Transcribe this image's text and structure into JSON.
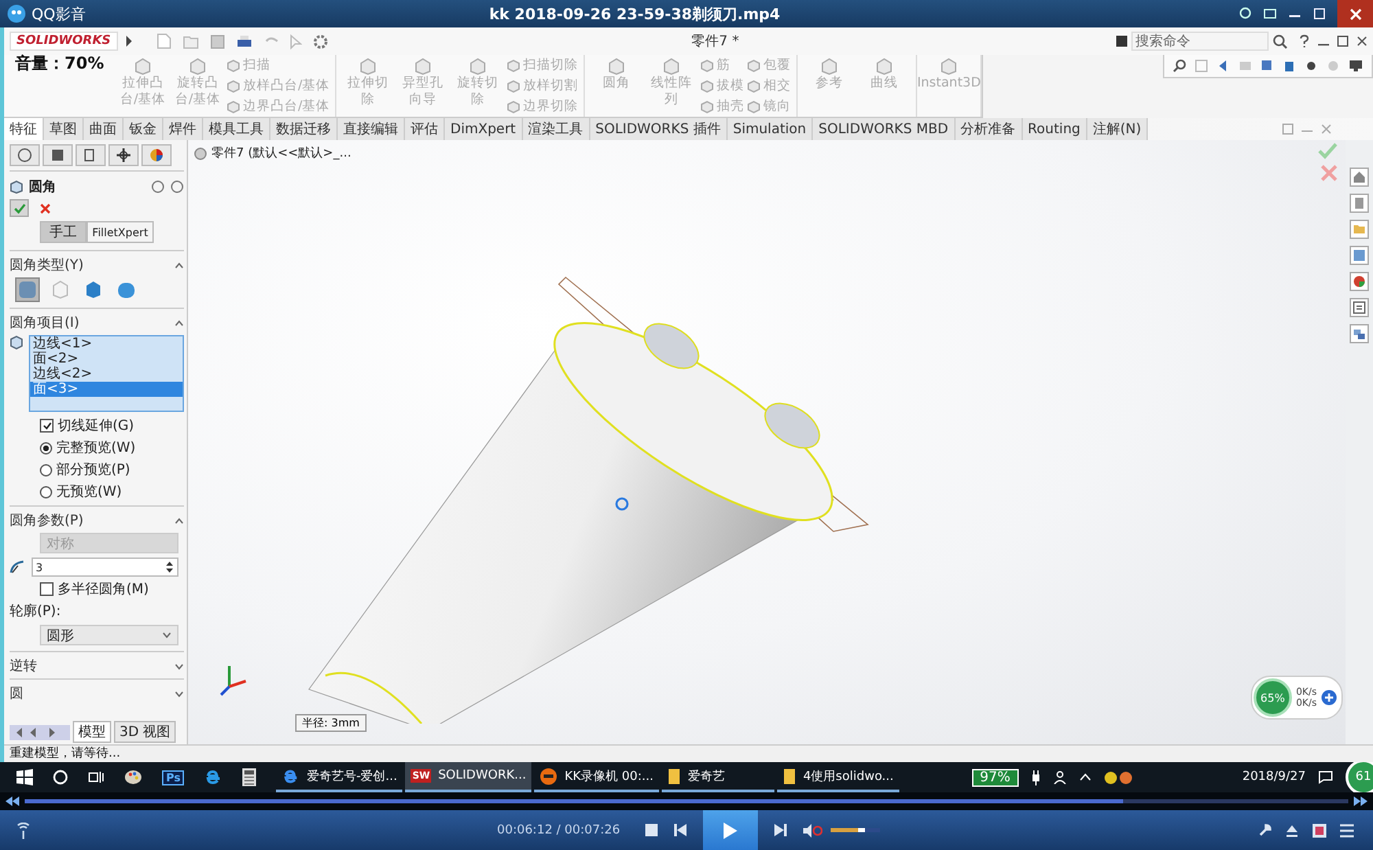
{
  "player": {
    "app_name": "QQ影音",
    "title": "kk 2018-09-26 23-59-38剃须刀.mp4",
    "osd": "音量：70%",
    "time": "00:06:12 / 00:07:26",
    "seek": {
      "level": 0.83
    },
    "volume": {
      "level": 0.7
    }
  },
  "solidworks": {
    "logo": "SOLIDWORKS",
    "document_title": "零件7 *",
    "search": {
      "placeholder": "搜索命令"
    },
    "ribbon": [
      [
        [
          "拉伸凸台/基体"
        ],
        [
          "旋转凸台/基体"
        ],
        [
          "扫描",
          "放样凸台/基体",
          "边界凸台/基体"
        ]
      ],
      [
        [
          "拉伸切除"
        ],
        [
          "异型孔向导"
        ],
        [
          "旋转切除"
        ],
        [
          "扫描切除",
          "放样切割",
          "边界切除"
        ]
      ],
      [
        [
          "圆角"
        ],
        [
          "线性阵列"
        ],
        [
          "筋",
          "拔模",
          "抽壳"
        ],
        [
          "包覆",
          "相交",
          "镜向"
        ]
      ],
      [
        [
          "参考"
        ],
        [
          "曲线"
        ]
      ],
      [
        [
          "Instant3D"
        ]
      ]
    ],
    "tabs": [
      {
        "label": "特征",
        "selected": true
      },
      {
        "label": "草图",
        "selected": false
      },
      {
        "label": "曲面",
        "selected": false
      },
      {
        "label": "钣金",
        "selected": false
      },
      {
        "label": "焊件",
        "selected": false
      },
      {
        "label": "模具工具",
        "selected": false
      },
      {
        "label": "数据迁移",
        "selected": false
      },
      {
        "label": "直接编辑",
        "selected": false
      },
      {
        "label": "评估",
        "selected": false
      },
      {
        "label": "DimXpert",
        "selected": false
      },
      {
        "label": "渲染工具",
        "selected": false
      },
      {
        "label": "SOLIDWORKS 插件",
        "selected": false
      },
      {
        "label": "Simulation",
        "selected": false
      },
      {
        "label": "SOLIDWORKS MBD",
        "selected": false
      },
      {
        "label": "分析准备",
        "selected": false
      },
      {
        "label": "Routing",
        "selected": false
      },
      {
        "label": "注解(N)",
        "selected": false
      }
    ],
    "property_manager": {
      "title": "圆角",
      "mode_buttons": [
        {
          "label": "手工",
          "selected": true
        },
        {
          "label": "FilletXpert",
          "selected": false
        }
      ],
      "fillet_type": {
        "title": "圆角类型(Y)",
        "options": [
          {
            "kind": "constant",
            "selected": true
          },
          {
            "kind": "variable",
            "selected": false
          },
          {
            "kind": "face",
            "selected": false
          },
          {
            "kind": "full",
            "selected": false
          }
        ]
      },
      "items": {
        "title": "圆角项目(I)",
        "entries": [
          {
            "label": "边线<1>",
            "selected": false
          },
          {
            "label": "面<2>",
            "selected": false
          },
          {
            "label": "边线<2>",
            "selected": false
          },
          {
            "label": "面<3>",
            "selected": true
          }
        ]
      },
      "options": [
        {
          "kind": "checkbox",
          "label": "切线延伸(G)",
          "checked": true
        },
        {
          "kind": "radio",
          "label": "完整预览(W)",
          "checked": true
        },
        {
          "kind": "radio",
          "label": "部分预览(P)",
          "checked": false
        },
        {
          "kind": "radio",
          "label": "无预览(W)",
          "checked": false
        }
      ],
      "parameters": {
        "title": "圆角参数(P)",
        "method": "对称",
        "radius": "3",
        "multi_radius": {
          "label": "多半径圆角(M)",
          "checked": false
        },
        "profile_label": "轮廓(P):",
        "profile": "圆形"
      },
      "collapsed_sections": [
        "逆转",
        "圆"
      ],
      "bottom_tabs": [
        {
          "label": "模型",
          "selected": true
        },
        {
          "label": "3D 视图",
          "selected": false
        }
      ]
    },
    "tree_item": "零件7 (默认<<默认>_...",
    "dimension_label": "半径: 3mm",
    "status": "重建模型，请等待...",
    "net_widget": {
      "percent": "65%",
      "up": "0K/s",
      "down": "0K/s"
    }
  },
  "taskbar": {
    "pinned": [
      {
        "kind": "paint"
      },
      {
        "kind": "ps",
        "text": "Ps"
      },
      {
        "kind": "ie"
      },
      {
        "kind": "calculator"
      }
    ],
    "items": [
      {
        "kind": "edge",
        "label": "爱奇艺号-爱创...",
        "selected": false
      },
      {
        "kind": "sw",
        "icon_text": "SW",
        "label": "SOLIDWORK...",
        "selected": true
      },
      {
        "kind": "kk",
        "label": "KK录像机 00:...",
        "selected": false
      },
      {
        "kind": "folder",
        "label": "爱奇艺",
        "selected": false
      },
      {
        "kind": "folder",
        "label": "4使用solidwo...",
        "selected": false
      }
    ],
    "battery": "97%",
    "date": "2018/9/27",
    "badge": "61"
  }
}
